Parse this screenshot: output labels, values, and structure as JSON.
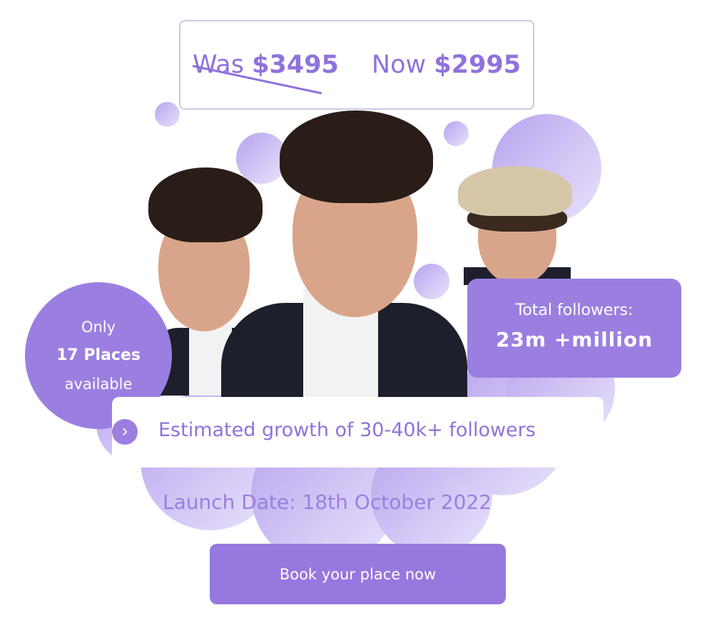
{
  "price": {
    "was_label": "Was",
    "was_amount": "$3495",
    "now_label": "Now",
    "now_amount": "$2995"
  },
  "availability": {
    "line1": "Only",
    "line2": "17 Places",
    "line3": "available"
  },
  "followers": {
    "label": "Total followers:",
    "value": "23m +million"
  },
  "growth": {
    "icon": "chevron-right-icon",
    "text": "Estimated growth of 30-40k+ followers"
  },
  "launch": {
    "text": "Launch Date: 18th October 2022"
  },
  "cta": {
    "label": "Book your place now"
  },
  "colors": {
    "accent": "#9a7fe0",
    "accent_text": "#8f72dc",
    "bubble_light": "#e9e3fb"
  }
}
